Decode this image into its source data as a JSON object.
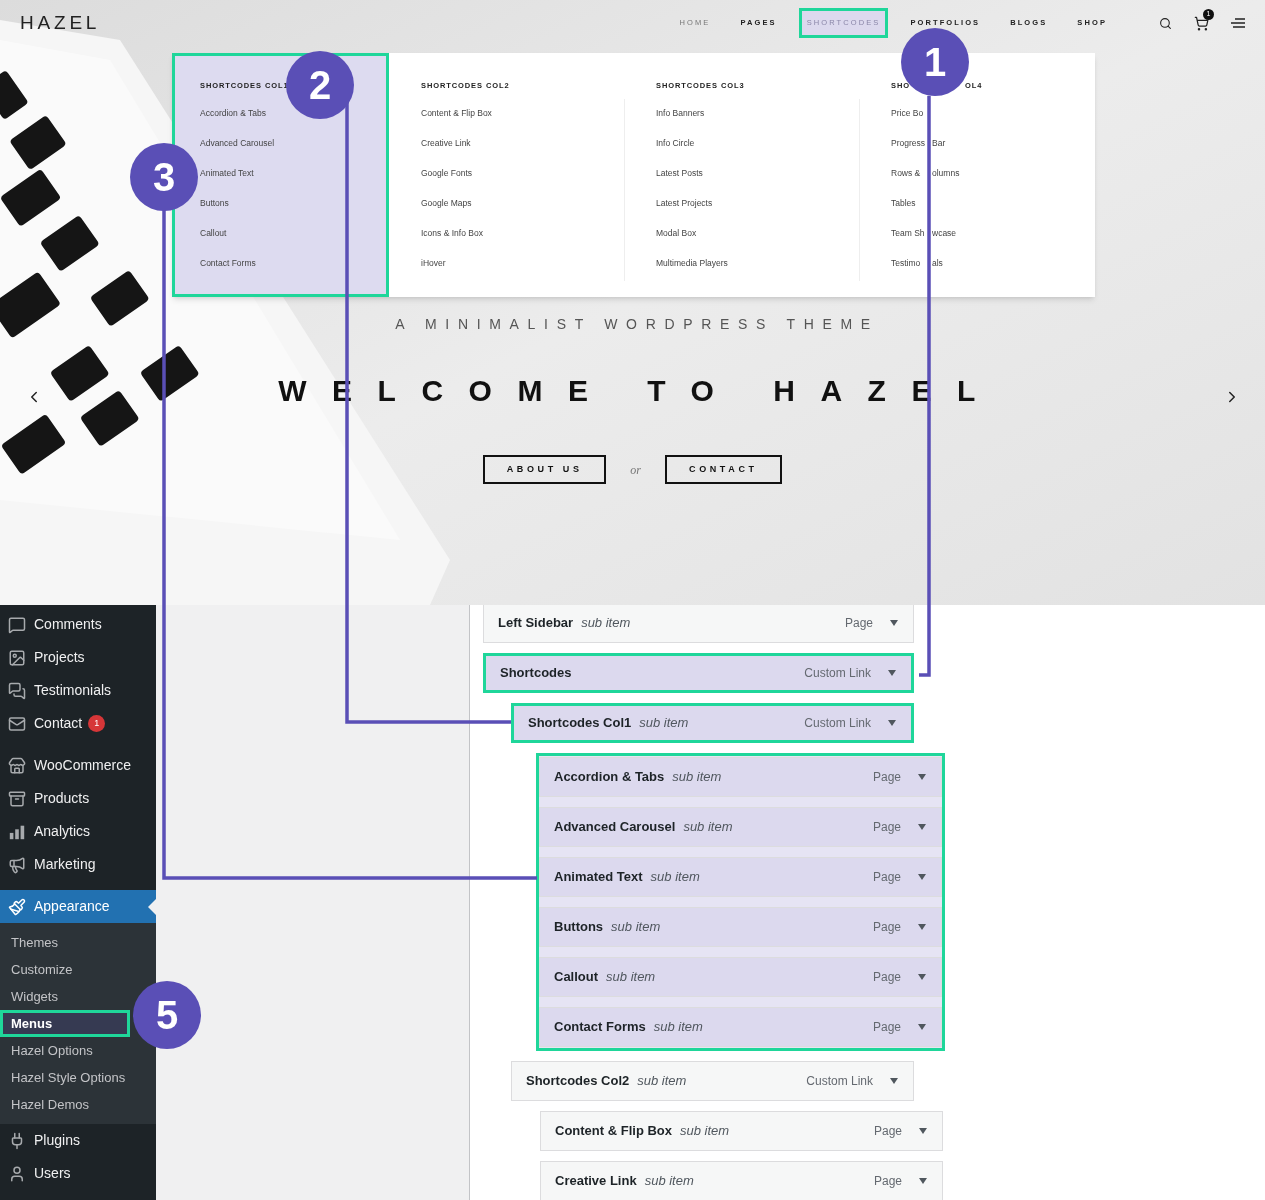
{
  "site": {
    "logo": "HAZEL",
    "nav": [
      {
        "label": "HOME",
        "selected": false
      },
      {
        "label": "PAGES",
        "selected": false
      },
      {
        "label": "SHORTCODES",
        "selected": true,
        "framed": true
      },
      {
        "label": "PORTFOLIOS",
        "selected": false
      },
      {
        "label": "BLOGS",
        "selected": false
      },
      {
        "label": "SHOP",
        "selected": false
      }
    ],
    "cart_count": "1"
  },
  "mega_menu": {
    "columns": [
      {
        "heading": [
          "SHORTCODES COL1"
        ],
        "highlighted": true,
        "framed": true,
        "items": [
          [
            "Accordion & Tabs"
          ],
          [
            "Advanced Carousel"
          ],
          [
            "Animated Text"
          ],
          [
            "Buttons"
          ],
          [
            "Callout"
          ],
          [
            "Contact Forms"
          ]
        ]
      },
      {
        "heading": [
          "SHORTCODES COL2"
        ],
        "highlighted": false,
        "items": [
          [
            "Content & Flip Box"
          ],
          [
            "Creative Link"
          ],
          [
            "Google Fonts"
          ],
          [
            "Google Maps"
          ],
          [
            "Icons & Info Box"
          ],
          [
            "iHover"
          ]
        ]
      },
      {
        "heading": [
          "SHORTCODES COL3"
        ],
        "highlighted": false,
        "items": [
          [
            "Info Banners"
          ],
          [
            "Info Circle"
          ],
          [
            "Latest Posts"
          ],
          [
            "Latest Projects"
          ],
          [
            "Modal Box"
          ],
          [
            "Multimedia Players"
          ]
        ]
      },
      {
        "heading": [
          "SHO",
          "OL4"
        ],
        "highlighted": false,
        "items": [
          [
            "Price Bo"
          ],
          [
            "Progress",
            "Bar"
          ],
          [
            "Rows &",
            "olumns"
          ],
          [
            "Tables"
          ],
          [
            "Team Sh",
            "wcase"
          ],
          [
            "Testimo",
            "als"
          ]
        ]
      }
    ]
  },
  "hero": {
    "tagline": "A MINIMALIST WORDPRESS THEME",
    "title": "WELCOME TO HAZEL",
    "buttons": [
      "ABOUT US",
      "CONTACT"
    ],
    "separator": "or"
  },
  "admin_menu": {
    "groups": [
      [
        {
          "label": "Comments",
          "selected": false
        },
        {
          "label": "Projects",
          "selected": false
        },
        {
          "label": "Testimonials",
          "selected": false
        },
        {
          "label": "Contact",
          "selected": false,
          "badge": "1"
        }
      ],
      [
        {
          "label": "WooCommerce",
          "selected": false
        },
        {
          "label": "Products",
          "selected": false
        },
        {
          "label": "Analytics",
          "selected": false
        },
        {
          "label": "Marketing",
          "selected": false
        }
      ],
      [
        {
          "label": "Appearance",
          "selected": true,
          "children": [
            {
              "label": "Themes",
              "selected": false
            },
            {
              "label": "Customize",
              "selected": false
            },
            {
              "label": "Widgets",
              "selected": false
            },
            {
              "label": "Menus",
              "selected": true,
              "framed": true
            },
            {
              "label": "Hazel Options",
              "selected": false
            },
            {
              "label": "Hazel Style Options",
              "selected": false
            },
            {
              "label": "Hazel Demos",
              "selected": false
            }
          ]
        },
        {
          "label": "Plugins",
          "selected": false
        },
        {
          "label": "Users",
          "selected": false
        }
      ]
    ]
  },
  "menu_items": [
    {
      "children": [
        {
          "title": "Left Sidebar",
          "note": "sub item",
          "type": "Page",
          "highlighted": false
        }
      ]
    },
    {
      "title": "Shortcodes",
      "type": "Custom Link",
      "highlighted": true,
      "framed": true,
      "children": [
        {
          "title": "Shortcodes Col1",
          "note": "sub item",
          "type": "Custom Link",
          "highlighted": true,
          "framed": true,
          "children_framed": true,
          "children": [
            {
              "title": "Accordion & Tabs",
              "note": "sub item",
              "type": "Page",
              "highlighted": true
            },
            {
              "title": "Advanced Carousel",
              "note": "sub item",
              "type": "Page",
              "highlighted": true
            },
            {
              "title": "Animated Text",
              "note": "sub item",
              "type": "Page",
              "highlighted": true
            },
            {
              "title": "Buttons",
              "note": "sub item",
              "type": "Page",
              "highlighted": true
            },
            {
              "title": "Callout",
              "note": "sub item",
              "type": "Page",
              "highlighted": true
            },
            {
              "title": "Contact Forms",
              "note": "sub item",
              "type": "Page",
              "highlighted": true
            }
          ]
        },
        {
          "title": "Shortcodes Col2",
          "note": "sub item",
          "type": "Custom Link",
          "highlighted": false,
          "children": [
            {
              "title": "Content & Flip Box",
              "note": "sub item",
              "type": "Page",
              "highlighted": false
            },
            {
              "title": "Creative Link",
              "note": "sub item",
              "type": "Page",
              "highlighted": false
            }
          ]
        }
      ]
    }
  ],
  "annotations": [
    "1",
    "2",
    "3",
    "5"
  ]
}
